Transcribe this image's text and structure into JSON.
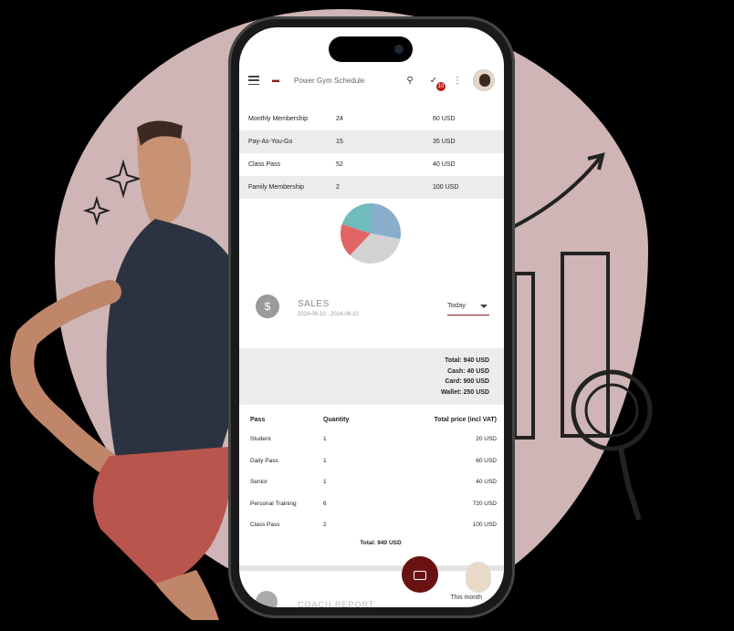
{
  "app": {
    "title": "Power Gym Schedule",
    "notification_count": "10",
    "icons": [
      "menu-icon",
      "dumbbell-icon",
      "search-icon",
      "check-circle-icon",
      "more-vert-icon"
    ]
  },
  "memberships": [
    {
      "name": "Monthly Membership",
      "qty": "24",
      "price": "60 USD"
    },
    {
      "name": "Pay-As-You-Go",
      "qty": "15",
      "price": "35 USD"
    },
    {
      "name": "Class Pass",
      "qty": "52",
      "price": "40 USD"
    },
    {
      "name": "Family Membership",
      "qty": "2",
      "price": "100 USD"
    }
  ],
  "pie": {
    "colors": [
      "#88aecb",
      "#d2d2d2",
      "#e26565",
      "#6fbcbc"
    ],
    "shares": [
      0.28,
      0.34,
      0.18,
      0.2
    ]
  },
  "sales": {
    "title": "SALES",
    "range": "2024-06-10 - 2024-06-10",
    "period": "Today"
  },
  "totals": {
    "total": "Total: 940 USD",
    "cash": "Cash: 40 USD",
    "card": "Card: 900 USD",
    "wallet": "Wallet: 250 USD"
  },
  "passes": {
    "headers": [
      "Pass",
      "Quantity",
      "Total price (incl VAT)"
    ],
    "rows": [
      {
        "pass": "Student",
        "qty": "1",
        "price": "20 USD"
      },
      {
        "pass": "Daily Pass",
        "qty": "1",
        "price": "60 USD"
      },
      {
        "pass": "Senior",
        "qty": "1",
        "price": "40 USD"
      },
      {
        "pass": "Personal Training",
        "qty": "6",
        "price": "720 USD"
      },
      {
        "pass": "Class Pass",
        "qty": "2",
        "price": "100 USD"
      }
    ],
    "total": "Total: 940 USD"
  },
  "bottom": {
    "label": "COACH REPORT",
    "month": "This month"
  },
  "accent": "#8a1c1c"
}
